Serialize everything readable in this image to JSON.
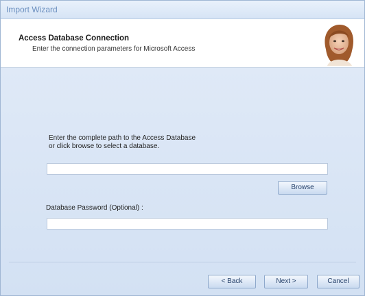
{
  "window": {
    "title": "Import Wizard"
  },
  "header": {
    "title": "Access Database Connection",
    "subtitle": "Enter the connection parameters for Microsoft Access"
  },
  "form": {
    "path_prompt": "Enter the complete path to the Access Database\nor click browse to select a database.",
    "path_value": "",
    "browse_label": "Browse",
    "password_label": "Database Password (Optional) :",
    "password_value": ""
  },
  "footer": {
    "back_label": "< Back",
    "next_label": "Next >",
    "cancel_label": "Cancel"
  },
  "colors": {
    "accent": "#6b8fbf",
    "panel": "#d9e6f5",
    "button_text": "#27426b"
  },
  "icons": {
    "avatar": "user-photo-icon"
  }
}
